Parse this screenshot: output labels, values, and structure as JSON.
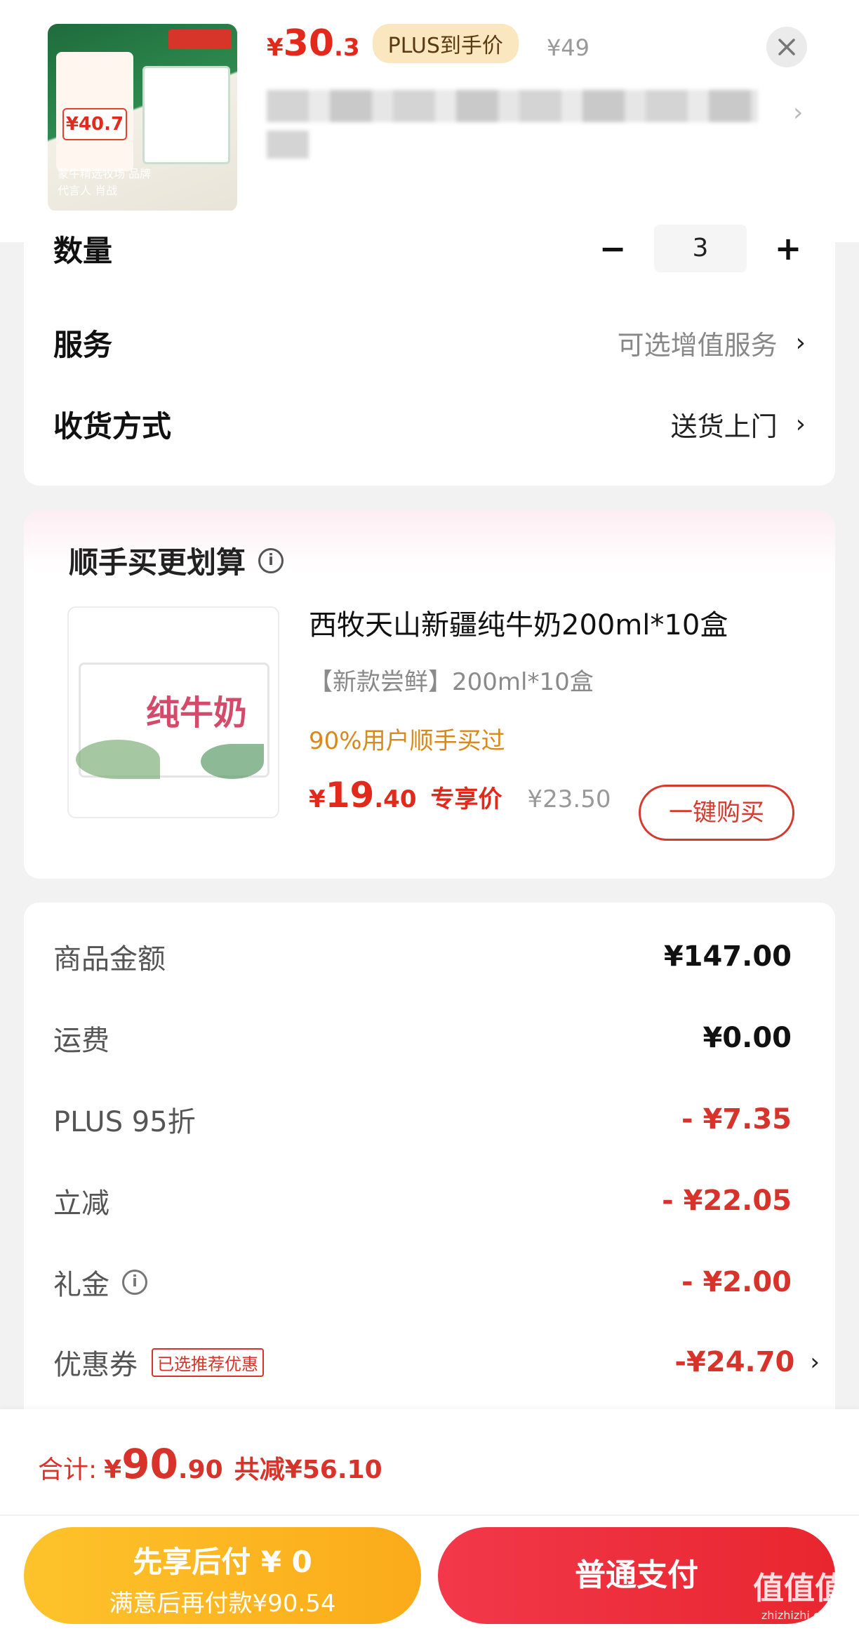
{
  "header": {
    "product_image_caption": "蒙牛精选牧场 品牌代言人 肖战",
    "promo_badge_price": "¥40.7",
    "price_symbol": "¥",
    "price_int": "30",
    "price_dec": ".3",
    "plus_badge": "PLUS到手价",
    "original_price": "¥49",
    "close_icon": "close-icon"
  },
  "options": {
    "quantity_label": "数量",
    "quantity_value": "3",
    "minus_label": "−",
    "plus_label": "+",
    "service_label": "服务",
    "service_value": "可选增值服务",
    "delivery_label": "收货方式",
    "delivery_value": "送货上门",
    "chevron": "›"
  },
  "recommend": {
    "title": "顺手买更划算",
    "info_icon": "i",
    "product_title": "西牧天山新疆纯牛奶200ml*10盒",
    "spec": "【新款尝鲜】200ml*10盒",
    "hint": "90%用户顺手买过",
    "price_symbol": "¥",
    "price_int": "19",
    "price_dec": ".40",
    "exclusive_label": "专享价",
    "original_price": "¥23.50",
    "buy_button": "一键购买",
    "image_text": "纯牛奶"
  },
  "fees": [
    {
      "label": "商品金额",
      "value": "¥147.00",
      "red": false
    },
    {
      "label": "运费",
      "value": "¥0.00",
      "red": false
    },
    {
      "label": "PLUS 95折",
      "value": "- ¥7.35",
      "red": true
    },
    {
      "label": "立减",
      "value": "- ¥22.05",
      "red": true
    },
    {
      "label": "礼金",
      "value": "- ¥2.00",
      "red": true
    },
    {
      "label": "优惠券",
      "value": "-¥24.70",
      "red": true
    }
  ],
  "coupon_badge": "已选推荐优惠",
  "total": {
    "label": "合计:",
    "symbol": "¥",
    "int": "90",
    "dec": ".90",
    "saved": "共减¥56.10"
  },
  "buttons": {
    "pay_later_line1": "先享后付 ¥ 0",
    "pay_later_line2": "满意后再付款¥90.54",
    "pay_normal": "普通支付"
  },
  "watermark": {
    "main": "值值值",
    "sub": "zhizhizhi.com"
  },
  "colors": {
    "accent_red": "#e3281c",
    "plus_gold": "#fbe7bf",
    "pay_later_yellow": "#fdc32b",
    "pay_normal_red": "#ea2a34"
  }
}
